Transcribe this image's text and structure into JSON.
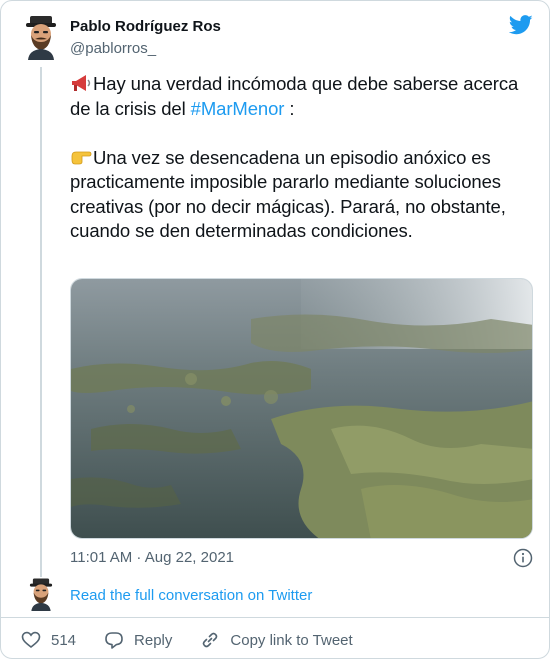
{
  "author": {
    "name": "Pablo Rodríguez Ros",
    "handle": "@pablorros_",
    "avatar_icon": "bearded-man-avatar"
  },
  "tweet": {
    "line1_text": "Hay una verdad incómoda que debe saberse acerca de la crisis del ",
    "hashtag": "#MarMenor",
    "line1_suffix": " :",
    "emoji1": "megaphone-icon",
    "emoji2": "pointing-finger-icon",
    "paragraph2": "Una vez se desencadena un episodio anóxico es practicamente imposible pararlo mediante soluciones creativas (por no decir mágicas). Parará, no obstante, cuando se den determinadas condiciones.",
    "image_alt_icon": "algae-lagoon-photo"
  },
  "timestamp": "11:01 AM · Aug 22, 2021",
  "read_link": "Read the full conversation on Twitter",
  "actions": {
    "like_count": "514",
    "reply_label": "Reply",
    "copy_label": "Copy link to Tweet"
  },
  "colors": {
    "accent": "#1d9bf0",
    "secondary_text": "#536471",
    "border": "#cfd9de",
    "like_red": "#f91880"
  }
}
